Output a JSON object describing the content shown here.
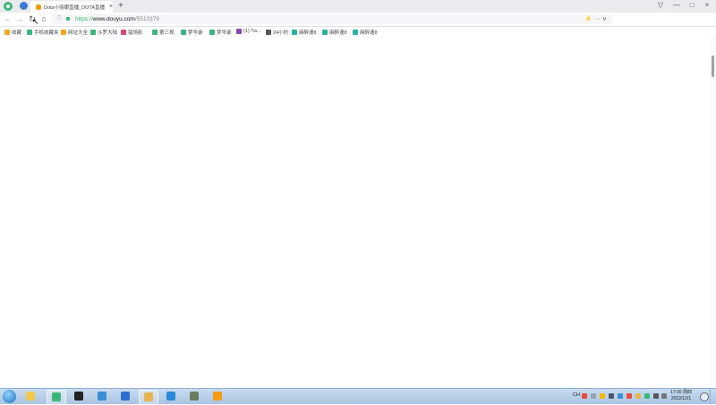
{
  "browser": {
    "tab": {
      "title": "Dota小丽娜直播_DOTA直播",
      "close": "×"
    },
    "new_tab": "+",
    "window_controls": [
      "—",
      "□",
      "×"
    ],
    "url": {
      "scheme": "https://",
      "host": "www.douyu.com",
      "path": "/5510379"
    },
    "url_right": "⚡ ··· ∨",
    "icons": [
      "back-icon",
      "forward-icon",
      "reload-icon",
      "home-icon",
      "shield-icon"
    ]
  },
  "bookmarks": [
    {
      "label": "收藏",
      "color": "#f5a623"
    },
    {
      "label": "手机收藏夹",
      "color": "#3bb878"
    },
    {
      "label": "网址大全",
      "color": "#f5a623"
    },
    {
      "label": "斗罗大陆",
      "color": "#3bb878"
    },
    {
      "label": "猎场影",
      "color": "#e0457b"
    },
    {
      "label": "第三视",
      "color": "#3bb878"
    },
    {
      "label": "梦华录",
      "color": "#3bb878"
    },
    {
      "label": "梦华录",
      "color": "#3bb878"
    },
    {
      "label": "(1) Tw...",
      "color": "#8e44ad"
    },
    {
      "label": "24小时",
      "color": "#555555"
    },
    {
      "label": "麻醉速8",
      "color": "#2bb2a4"
    },
    {
      "label": "麻醉速8",
      "color": "#2bb2a4"
    },
    {
      "label": "麻醉速8",
      "color": "#2bb2a4"
    }
  ],
  "taskbar": {
    "apps": [
      {
        "name": "explorer",
        "color": "#f2c94c"
      },
      {
        "name": "360-browser",
        "color": "#3bb878"
      },
      {
        "name": "obs",
        "color": "#222222"
      },
      {
        "name": "ie",
        "color": "#3a8fd8"
      },
      {
        "name": "app-blue",
        "color": "#2a6ed1"
      },
      {
        "name": "app-glasses",
        "color": "#e9b44c"
      },
      {
        "name": "app-cube",
        "color": "#2b88d8"
      },
      {
        "name": "app-face",
        "color": "#6b7d5e"
      },
      {
        "name": "app-orange",
        "color": "#f39c12"
      }
    ],
    "tray_text": "CH",
    "clock_time": "17:00 周四",
    "clock_date": "2022/12/1"
  }
}
